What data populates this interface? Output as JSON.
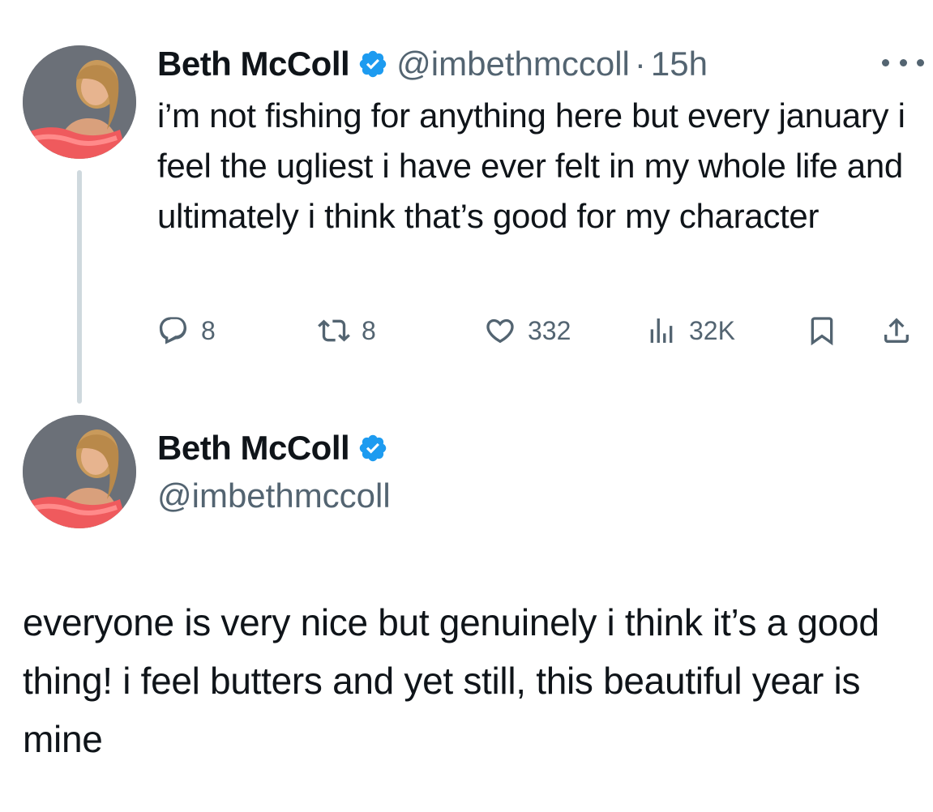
{
  "tweet": {
    "author_name": "Beth McColl",
    "handle": "@imbethmccoll",
    "separator": "·",
    "time": "15h",
    "text": "i’m not fishing for anything here but every january i feel the ugliest i have ever felt in my whole life and ultimately i think that’s good for my character",
    "actions": {
      "reply_count": "8",
      "retweet_count": "8",
      "like_count": "332",
      "views_count": "32K"
    },
    "icons": [
      "verified-badge-icon",
      "more-icon",
      "reply-icon",
      "retweet-icon",
      "like-icon",
      "views-icon",
      "bookmark-icon",
      "share-icon"
    ]
  },
  "reply": {
    "author_name": "Beth McColl",
    "handle": "@imbethmccoll",
    "text": "everyone is very nice but genuinely i think it’s a good thing! i feel butters and yet still, this beautiful year is mine"
  },
  "colors": {
    "verified": "#1d9bf0",
    "secondary_text": "#536471",
    "thread_line": "#cfd9de",
    "primary_text": "#0f1419"
  }
}
